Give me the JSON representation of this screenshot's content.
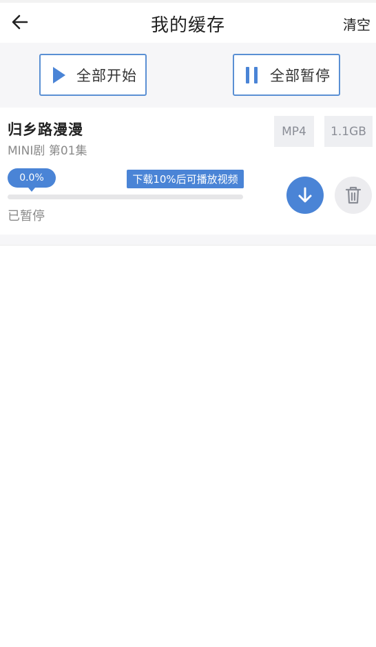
{
  "header": {
    "title": "我的缓存",
    "clear_label": "清空",
    "back_icon": "arrow-left-icon"
  },
  "toolbar": {
    "start_all_label": "全部开始",
    "pause_all_label": "全部暂停",
    "start_icon": "play-icon",
    "pause_icon": "pause-icon",
    "accent": "#4a84d6"
  },
  "items": [
    {
      "title": "归乡路漫漫",
      "subtitle": "MINI剧 第01集",
      "format": "MP4",
      "size": "1.1GB",
      "progress_text": "0.0%",
      "progress_fraction": 0.0,
      "hint": "下载10%后可播放视频",
      "status": "已暂停",
      "download_icon": "download-arrow-icon",
      "delete_icon": "trash-icon"
    }
  ]
}
